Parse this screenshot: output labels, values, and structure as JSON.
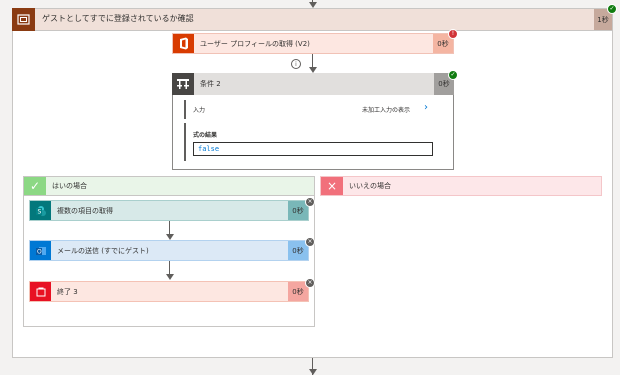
{
  "scope": {
    "title": "ゲストとしてすでに登録されているか確認",
    "duration": "1秒",
    "icon": "scope-icon",
    "color": "#8a3b12"
  },
  "get_profile": {
    "label": "ユーザー プロフィールの取得 (V2)",
    "duration": "0秒",
    "icon": "office-icon",
    "status": "error"
  },
  "insert_icon": "info-icon",
  "condition": {
    "label": "条件 2",
    "duration": "0秒",
    "icon": "condition-icon",
    "input_label": "入力",
    "show_raw": "未加工入力の表示",
    "result_label": "式の結果",
    "result_value": "false"
  },
  "yes_branch": {
    "label": "はいの場合",
    "actions": [
      {
        "label": "複数の項目の取得",
        "duration": "0秒",
        "icon": "sharepoint-icon"
      },
      {
        "label": "メールの送信 (すでにゲスト)",
        "duration": "0秒",
        "icon": "outlook-icon"
      },
      {
        "label": "終了 3",
        "duration": "0秒",
        "icon": "terminate-icon"
      }
    ]
  },
  "no_branch": {
    "label": "いいえの場合",
    "icon": "close-icon"
  }
}
